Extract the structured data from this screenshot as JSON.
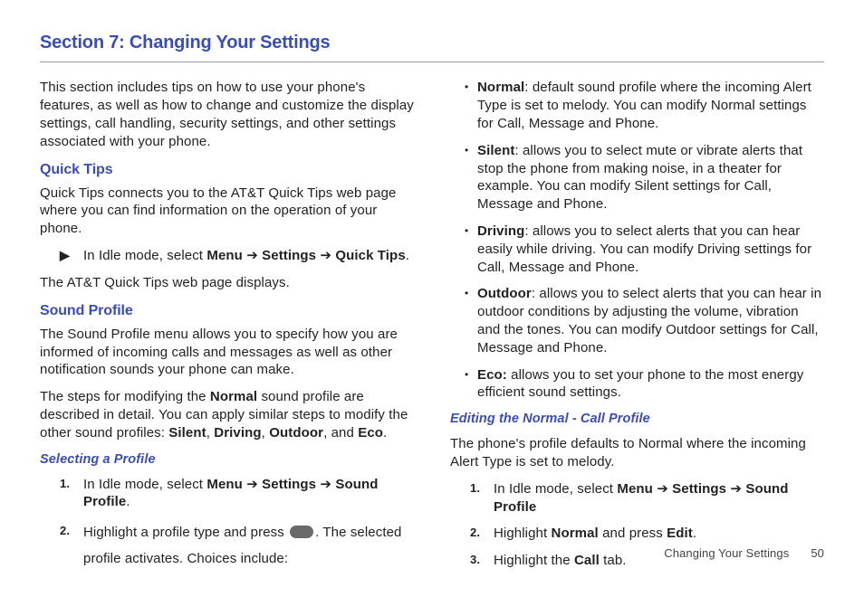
{
  "section": {
    "title": "Section 7: Changing Your Settings"
  },
  "col1": {
    "intro": "This section includes tips on how to use your phone's features, as well as how to change and customize the display settings, call handling, security settings, and other settings associated with your phone.",
    "quickTips": {
      "heading": "Quick Tips",
      "p1": "Quick Tips connects you to the AT&T Quick Tips web page where you can find information on the operation of your phone.",
      "step_prefix": "In Idle mode, select ",
      "menu": "Menu",
      "arrow1": " ➔ ",
      "settings": "Settings",
      "arrow2": " ➔ ",
      "quick": "Quick Tips",
      "period": ".",
      "p2": "The AT&T Quick Tips web page displays."
    },
    "sound": {
      "heading": "Sound Profile",
      "p1": "The Sound Profile menu allows you to specify how you are informed of incoming calls and messages as well as other notification sounds your phone can make.",
      "p2a": "The steps for modifying the ",
      "normal": "Normal",
      "p2b": " sound profile are described in detail. You can apply similar steps to modify the other sound profiles: ",
      "silent": "Silent",
      "c1": ", ",
      "driving": "Driving",
      "c2": ", ",
      "outdoor": "Outdoor",
      "c3": ", and ",
      "eco": "Eco",
      "dot": "."
    },
    "select": {
      "heading": "Selecting a Profile",
      "s1_pre": "In Idle mode, select ",
      "s1_menu": "Menu",
      "s1_a1": " ➔ ",
      "s1_settings": "Settings",
      "s1_a2": " ➔ ",
      "s1_sp": "Sound Profile",
      "s1_dot": ".",
      "s2_pre": "Highlight a profile type and press ",
      "s2_post": ". The selected profile activates. Choices include:"
    }
  },
  "col2": {
    "bullets": {
      "normal_l": "Normal",
      "normal_t": ": default sound profile where the incoming Alert Type is set to melody. You can modify Normal settings for Call, Message and Phone.",
      "silent_l": "Silent",
      "silent_t": ": allows you to select mute or vibrate alerts that stop the phone from making noise, in a theater for example. You can modify Silent settings for Call, Message and Phone.",
      "driving_l": "Driving",
      "driving_t": ": allows you to select alerts that you can hear easily while driving. You can modify Driving settings for Call, Message and Phone.",
      "outdoor_l": "Outdoor",
      "outdoor_t": ": allows you to select alerts that you can hear in outdoor conditions by adjusting the volume, vibration and the tones. You can modify Outdoor settings for Call, Message and Phone.",
      "eco_l": "Eco:",
      "eco_t": " allows you to set your phone to the most energy efficient sound settings."
    },
    "edit": {
      "heading": "Editing the Normal - Call Profile",
      "p1": "The phone's profile defaults to Normal where the incoming Alert Type is set to melody.",
      "s1_pre": "In Idle mode, select ",
      "s1_menu": "Menu",
      "s1_a1": " ➔ ",
      "s1_settings": "Settings",
      "s1_a2": " ➔ ",
      "s1_sp": "Sound Profile",
      "s2_pre": "Highlight ",
      "s2_normal": "Normal",
      "s2_mid": " and press ",
      "s2_edit": "Edit",
      "s2_dot": ".",
      "s3_pre": "Highlight the ",
      "s3_call": "Call",
      "s3_post": " tab."
    }
  },
  "footer": {
    "label": "Changing Your Settings",
    "page": "50"
  }
}
